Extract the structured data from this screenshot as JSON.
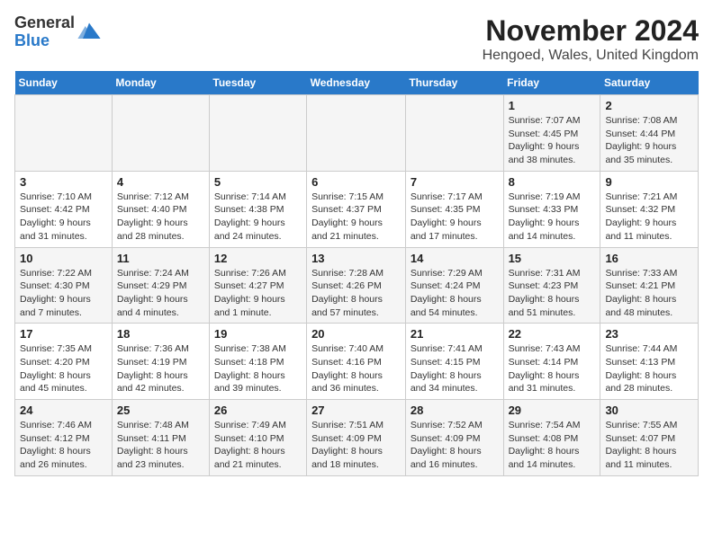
{
  "header": {
    "logo_line1": "General",
    "logo_line2": "Blue",
    "month_year": "November 2024",
    "location": "Hengoed, Wales, United Kingdom"
  },
  "weekdays": [
    "Sunday",
    "Monday",
    "Tuesday",
    "Wednesday",
    "Thursday",
    "Friday",
    "Saturday"
  ],
  "weeks": [
    [
      {
        "day": "",
        "info": ""
      },
      {
        "day": "",
        "info": ""
      },
      {
        "day": "",
        "info": ""
      },
      {
        "day": "",
        "info": ""
      },
      {
        "day": "",
        "info": ""
      },
      {
        "day": "1",
        "info": "Sunrise: 7:07 AM\nSunset: 4:45 PM\nDaylight: 9 hours\nand 38 minutes."
      },
      {
        "day": "2",
        "info": "Sunrise: 7:08 AM\nSunset: 4:44 PM\nDaylight: 9 hours\nand 35 minutes."
      }
    ],
    [
      {
        "day": "3",
        "info": "Sunrise: 7:10 AM\nSunset: 4:42 PM\nDaylight: 9 hours\nand 31 minutes."
      },
      {
        "day": "4",
        "info": "Sunrise: 7:12 AM\nSunset: 4:40 PM\nDaylight: 9 hours\nand 28 minutes."
      },
      {
        "day": "5",
        "info": "Sunrise: 7:14 AM\nSunset: 4:38 PM\nDaylight: 9 hours\nand 24 minutes."
      },
      {
        "day": "6",
        "info": "Sunrise: 7:15 AM\nSunset: 4:37 PM\nDaylight: 9 hours\nand 21 minutes."
      },
      {
        "day": "7",
        "info": "Sunrise: 7:17 AM\nSunset: 4:35 PM\nDaylight: 9 hours\nand 17 minutes."
      },
      {
        "day": "8",
        "info": "Sunrise: 7:19 AM\nSunset: 4:33 PM\nDaylight: 9 hours\nand 14 minutes."
      },
      {
        "day": "9",
        "info": "Sunrise: 7:21 AM\nSunset: 4:32 PM\nDaylight: 9 hours\nand 11 minutes."
      }
    ],
    [
      {
        "day": "10",
        "info": "Sunrise: 7:22 AM\nSunset: 4:30 PM\nDaylight: 9 hours\nand 7 minutes."
      },
      {
        "day": "11",
        "info": "Sunrise: 7:24 AM\nSunset: 4:29 PM\nDaylight: 9 hours\nand 4 minutes."
      },
      {
        "day": "12",
        "info": "Sunrise: 7:26 AM\nSunset: 4:27 PM\nDaylight: 9 hours\nand 1 minute."
      },
      {
        "day": "13",
        "info": "Sunrise: 7:28 AM\nSunset: 4:26 PM\nDaylight: 8 hours\nand 57 minutes."
      },
      {
        "day": "14",
        "info": "Sunrise: 7:29 AM\nSunset: 4:24 PM\nDaylight: 8 hours\nand 54 minutes."
      },
      {
        "day": "15",
        "info": "Sunrise: 7:31 AM\nSunset: 4:23 PM\nDaylight: 8 hours\nand 51 minutes."
      },
      {
        "day": "16",
        "info": "Sunrise: 7:33 AM\nSunset: 4:21 PM\nDaylight: 8 hours\nand 48 minutes."
      }
    ],
    [
      {
        "day": "17",
        "info": "Sunrise: 7:35 AM\nSunset: 4:20 PM\nDaylight: 8 hours\nand 45 minutes."
      },
      {
        "day": "18",
        "info": "Sunrise: 7:36 AM\nSunset: 4:19 PM\nDaylight: 8 hours\nand 42 minutes."
      },
      {
        "day": "19",
        "info": "Sunrise: 7:38 AM\nSunset: 4:18 PM\nDaylight: 8 hours\nand 39 minutes."
      },
      {
        "day": "20",
        "info": "Sunrise: 7:40 AM\nSunset: 4:16 PM\nDaylight: 8 hours\nand 36 minutes."
      },
      {
        "day": "21",
        "info": "Sunrise: 7:41 AM\nSunset: 4:15 PM\nDaylight: 8 hours\nand 34 minutes."
      },
      {
        "day": "22",
        "info": "Sunrise: 7:43 AM\nSunset: 4:14 PM\nDaylight: 8 hours\nand 31 minutes."
      },
      {
        "day": "23",
        "info": "Sunrise: 7:44 AM\nSunset: 4:13 PM\nDaylight: 8 hours\nand 28 minutes."
      }
    ],
    [
      {
        "day": "24",
        "info": "Sunrise: 7:46 AM\nSunset: 4:12 PM\nDaylight: 8 hours\nand 26 minutes."
      },
      {
        "day": "25",
        "info": "Sunrise: 7:48 AM\nSunset: 4:11 PM\nDaylight: 8 hours\nand 23 minutes."
      },
      {
        "day": "26",
        "info": "Sunrise: 7:49 AM\nSunset: 4:10 PM\nDaylight: 8 hours\nand 21 minutes."
      },
      {
        "day": "27",
        "info": "Sunrise: 7:51 AM\nSunset: 4:09 PM\nDaylight: 8 hours\nand 18 minutes."
      },
      {
        "day": "28",
        "info": "Sunrise: 7:52 AM\nSunset: 4:09 PM\nDaylight: 8 hours\nand 16 minutes."
      },
      {
        "day": "29",
        "info": "Sunrise: 7:54 AM\nSunset: 4:08 PM\nDaylight: 8 hours\nand 14 minutes."
      },
      {
        "day": "30",
        "info": "Sunrise: 7:55 AM\nSunset: 4:07 PM\nDaylight: 8 hours\nand 11 minutes."
      }
    ]
  ]
}
